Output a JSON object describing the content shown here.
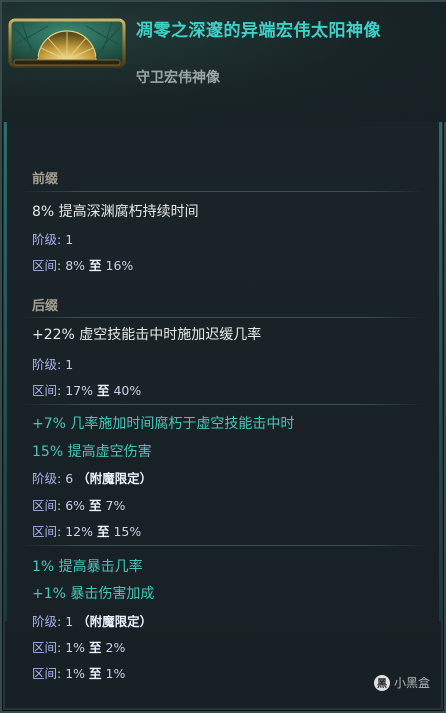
{
  "item": {
    "name": "凋零之深邃的异端宏伟太阳神像",
    "base_type": "守卫宏伟神像",
    "icon": "sun-idol-icon"
  },
  "prefix": {
    "header": "前缀",
    "stat": "8% 提高深渊腐朽持续时间",
    "tier_label": "阶级",
    "tier": ": 1",
    "range_label": "区间",
    "range_from": ": 8%",
    "range_to_word": "至",
    "range_to": "16%"
  },
  "suffix": {
    "header": "后缀",
    "stat": "+22% 虚空技能击中时施加迟缓几率",
    "tier_label": "阶级",
    "tier": ": 1",
    "range_label": "区间",
    "range_from": ": 17%",
    "range_to_word": "至",
    "range_to": "40%"
  },
  "affix3": {
    "stat1": "+7% 几率施加时间腐朽于虚空技能击中时",
    "stat2": "15% 提高虚空伤害",
    "tier_label": "阶级",
    "tier": ": 6",
    "tier_note": "（附魔限定）",
    "range1_label": "区间",
    "range1_from": ": 6%",
    "range1_to_word": "至",
    "range1_to": "7%",
    "range2_label": "区间",
    "range2_from": ": 12%",
    "range2_to_word": "至",
    "range2_to": "15%"
  },
  "affix4": {
    "stat1": "1% 提高暴击几率",
    "stat2": "+1% 暴击伤害加成",
    "tier_label": "阶级",
    "tier": ": 1",
    "tier_note": "（附魔限定）",
    "range1_label": "区间",
    "range1_from": ": 1%",
    "range1_to_word": "至",
    "range1_to": "2%",
    "range2_label": "区间",
    "range2_from": ": 1%",
    "range2_to_word": "至",
    "range2_to": "1%"
  },
  "watermark": {
    "text": "小黑盒",
    "logo": "黑"
  },
  "colors": {
    "title": "#3fd0c7",
    "cyan_stat": "#46c6b9",
    "white_stat": "#e7e9e6",
    "meta_key": "#a8b2f0",
    "section_header": "#a6a092"
  }
}
